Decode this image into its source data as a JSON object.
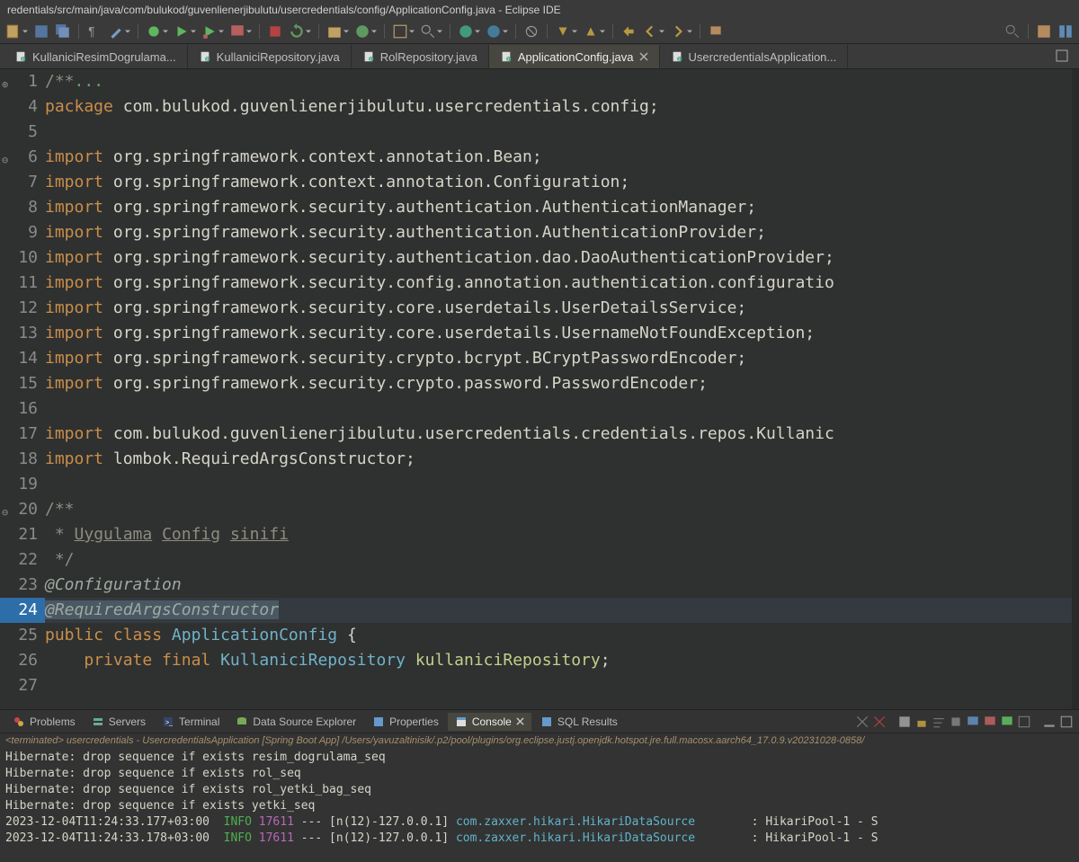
{
  "title": "redentials/src/main/java/com/bulukod/guvenlienerjibulutu/usercredentials/config/ApplicationConfig.java - Eclipse IDE",
  "tabs": [
    {
      "label": "KullaniciResimDogrulama...",
      "active": false
    },
    {
      "label": "KullaniciRepository.java",
      "active": false
    },
    {
      "label": "RolRepository.java",
      "active": false
    },
    {
      "label": "ApplicationConfig.java",
      "active": true
    },
    {
      "label": "UsercredentialsApplication...",
      "active": false
    }
  ],
  "code": {
    "l1": "/**",
    "l1n": "1",
    "l4n": "4",
    "l4_kw": "package",
    "l4_pkg": " com.bulukod.guvenlienerjibulutu.usercredentials.config;",
    "l5n": "5",
    "l6n": "6",
    "imp": "import",
    "l6_pkg": " org.springframework.context.annotation.Bean;",
    "l7n": "7",
    "l7_pkg": " org.springframework.context.annotation.Configuration;",
    "l8n": "8",
    "l8_pkg": " org.springframework.security.authentication.AuthenticationManager;",
    "l9n": "9",
    "l9_pkg": " org.springframework.security.authentication.AuthenticationProvider;",
    "l10n": "10",
    "l10_pkg": " org.springframework.security.authentication.dao.DaoAuthenticationProvider;",
    "l11n": "11",
    "l11_pkg": " org.springframework.security.config.annotation.authentication.configuratio",
    "l12n": "12",
    "l12_pkg": " org.springframework.security.core.userdetails.UserDetailsService;",
    "l13n": "13",
    "l13_pkg": " org.springframework.security.core.userdetails.UsernameNotFoundException;",
    "l14n": "14",
    "l14_pkg": " org.springframework.security.crypto.bcrypt.BCryptPasswordEncoder;",
    "l15n": "15",
    "l15_pkg": " org.springframework.security.crypto.password.PasswordEncoder;",
    "l16n": "16",
    "l17n": "17",
    "l17_pkg": " com.bulukod.guvenlienerjibulutu.usercredentials.credentials.repos.Kullanic",
    "l18n": "18",
    "l18_pkg": " lombok.RequiredArgsConstructor;",
    "l19n": "19",
    "l20n": "20",
    "l20_c": "/**",
    "l21n": "21",
    "l21_p": " * ",
    "l21_u": "Uygulama",
    "l21_s": " ",
    "l21_c": "Config",
    "l21_s2": " ",
    "l21_si": "sinifi",
    "l22n": "22",
    "l22_c": " */",
    "l23n": "23",
    "l23_a": "@Configuration",
    "l24n": "24",
    "l24_a": "@RequiredArgsConstructor",
    "l25n": "25",
    "l25_p": "public",
    "l25_c": " class ",
    "l25_t": "ApplicationConfig",
    "l25_b": " {",
    "l26n": "26",
    "l26_i": "    ",
    "l26_p": "private",
    "l26_f": " final ",
    "l26_t": "KullaniciRepository",
    "l26_s": " ",
    "l26_v": "kullaniciRepository",
    "l26_e": ";",
    "l27n": "27"
  },
  "bottomTabs": [
    {
      "label": "Problems"
    },
    {
      "label": "Servers"
    },
    {
      "label": "Terminal"
    },
    {
      "label": "Data Source Explorer"
    },
    {
      "label": "Properties"
    },
    {
      "label": "Console",
      "active": true
    },
    {
      "label": "SQL Results"
    }
  ],
  "consoleMeta": "<terminated> usercredentials - UsercredentialsApplication [Spring Boot App] /Users/yavuzaltinisik/.p2/pool/plugins/org.eclipse.justj.openjdk.hotspot.jre.full.macosx.aarch64_17.0.9.v20231028-0858/",
  "consoleLines": [
    {
      "text": "Hibernate: drop sequence if exists resim_dogrulama_seq"
    },
    {
      "text": "Hibernate: drop sequence if exists rol_seq"
    },
    {
      "text": "Hibernate: drop sequence if exists rol_yetki_bag_seq"
    },
    {
      "text": "Hibernate: drop sequence if exists yetki_seq"
    },
    {
      "ts": "2023-12-04T11:24:33.177+03:00  ",
      "lvl": "INFO",
      "pid": " 17611",
      "mid": " --- [n(12)-127.0.0.1] ",
      "cls": "com.zaxxer.hikari.HikariDataSource",
      "tail": "        : HikariPool-1 - S"
    },
    {
      "ts": "2023-12-04T11:24:33.178+03:00  ",
      "lvl": "INFO",
      "pid": " 17611",
      "mid": " --- [n(12)-127.0.0.1] ",
      "cls": "com.zaxxer.hikari.HikariDataSource",
      "tail": "        : HikariPool-1 - S"
    }
  ]
}
